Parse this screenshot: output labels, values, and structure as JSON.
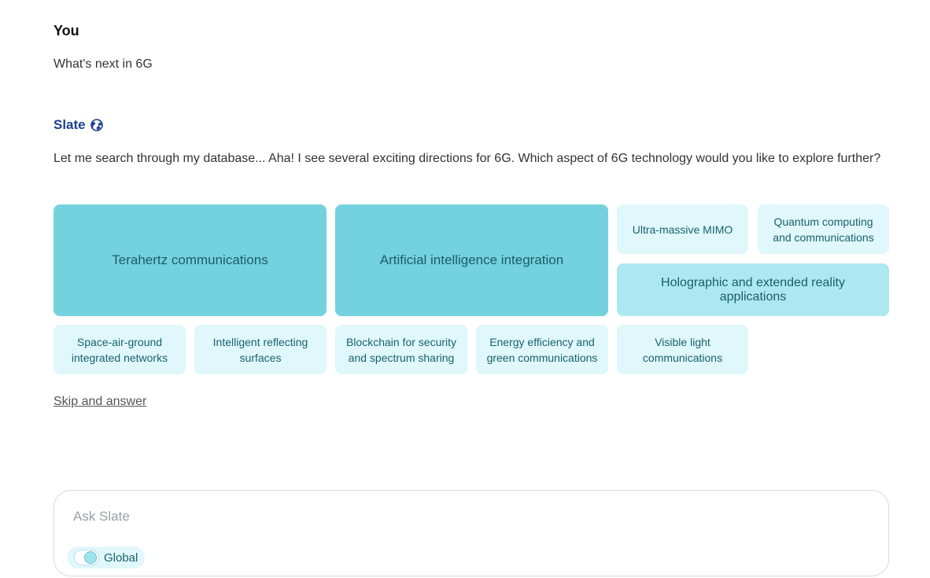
{
  "user": {
    "name": "You",
    "message": "What's next in 6G"
  },
  "bot": {
    "name": "Slate",
    "icon": "globe-icon",
    "message": "Let me search through my database... Aha! I see several exciting directions for 6G. Which aspect of 6G technology would you like to explore further?"
  },
  "options": [
    {
      "label": "Terahertz communications",
      "size": "large"
    },
    {
      "label": "Artificial intelligence integration",
      "size": "large"
    },
    {
      "label": "Ultra-massive MIMO",
      "size": "small"
    },
    {
      "label": "Quantum computing and communications",
      "size": "small"
    },
    {
      "label": "Holographic and extended reality applications",
      "size": "medium"
    },
    {
      "label": "Space-air-ground integrated networks",
      "size": "small"
    },
    {
      "label": "Intelligent reflecting surfaces",
      "size": "small"
    },
    {
      "label": "Blockchain for security and spectrum sharing",
      "size": "small"
    },
    {
      "label": "Energy efficiency and green communications",
      "size": "small"
    },
    {
      "label": "Visible light communications",
      "size": "small"
    }
  ],
  "skip_label": "Skip and answer",
  "composer": {
    "placeholder": "Ask Slate",
    "value": "",
    "toggle_label": "Global",
    "toggle_on": true
  },
  "colors": {
    "accent_name": "#1b3f8f",
    "tile_large": "#74d2df",
    "tile_medium": "#ade8f2",
    "tile_small": "#e0f7fb"
  }
}
